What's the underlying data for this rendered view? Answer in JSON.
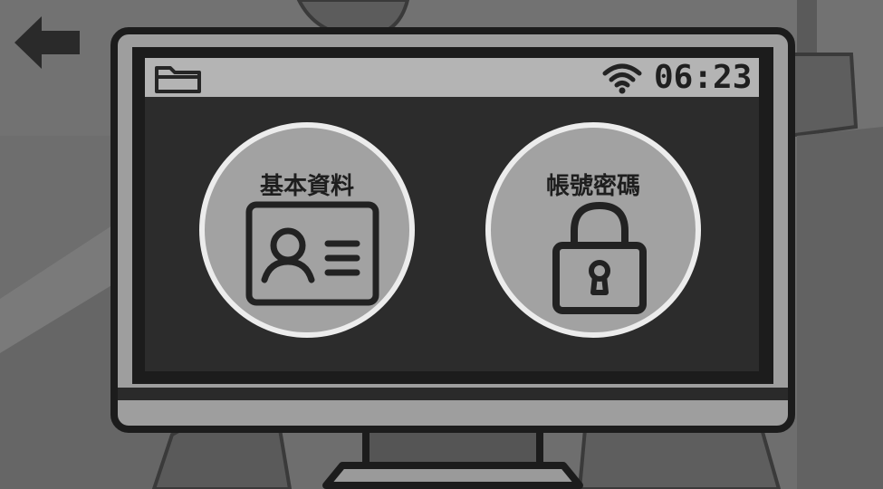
{
  "status_bar": {
    "folder_icon": "folder-icon",
    "wifi_icon": "wifi-icon",
    "time": "06:23"
  },
  "apps": [
    {
      "label": "基本資料",
      "icon": "id-card-icon"
    },
    {
      "label": "帳號密碼",
      "icon": "lock-icon"
    }
  ],
  "navigation": {
    "back_icon": "back-arrow-icon"
  },
  "colors": {
    "background": "#6a6a6a",
    "monitor_frame": "#1c1c1c",
    "screen": "#2b2b2b",
    "status_bar": "#b4b4b4",
    "app_circle": "#a2a2a2",
    "app_ring": "#ececec"
  }
}
